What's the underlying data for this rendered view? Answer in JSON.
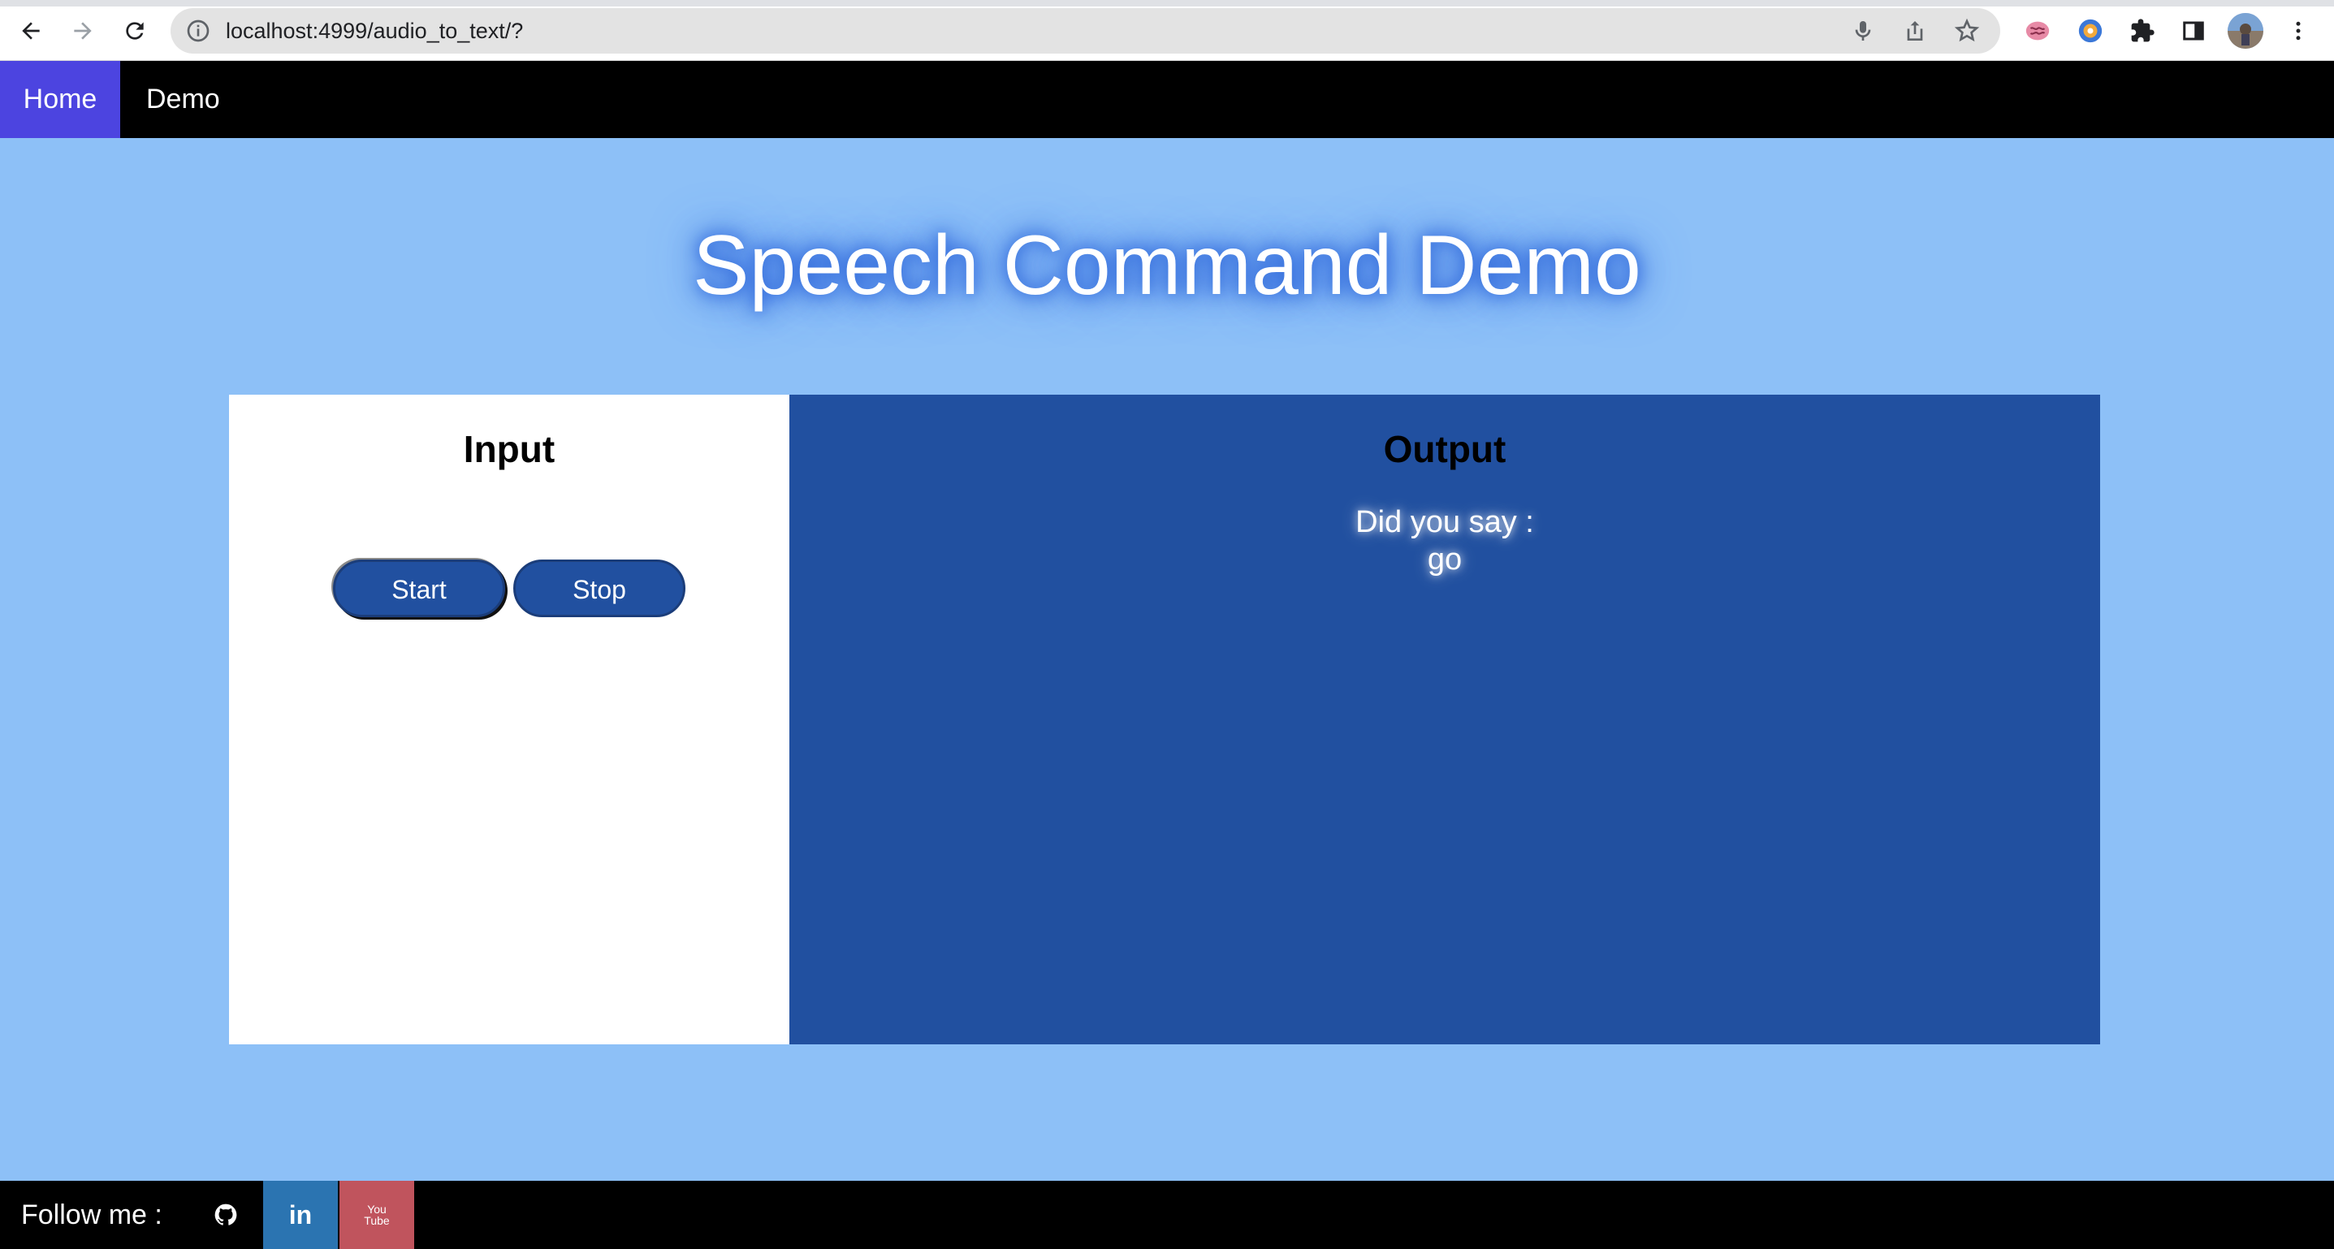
{
  "browser": {
    "url": "localhost:4999/audio_to_text/?",
    "toolbar_icons": [
      "back-arrow-icon",
      "forward-arrow-icon",
      "reload-icon",
      "site-info-icon",
      "microphone-icon",
      "share-icon",
      "bookmark-star-icon",
      "extension-brain-icon",
      "extension-donut-icon",
      "extensions-puzzle-icon",
      "side-panel-icon",
      "profile-avatar",
      "kebab-menu-icon"
    ]
  },
  "nav": {
    "home": "Home",
    "demo": "Demo",
    "active_color": "#4c44e0"
  },
  "page": {
    "title": "Speech Command Demo",
    "background": "#8dc0f7"
  },
  "input_panel": {
    "heading": "Input",
    "start_label": "Start",
    "stop_label": "Stop"
  },
  "output_panel": {
    "heading": "Output",
    "prompt": "Did you say :",
    "result": "go",
    "background": "#2150a0"
  },
  "footer": {
    "follow_label": "Follow me :",
    "links": [
      {
        "icon": "github-icon",
        "color": "#000000"
      },
      {
        "icon": "linkedin-icon",
        "text": "in",
        "color": "#2b74b1"
      },
      {
        "icon": "youtube-icon",
        "text": "You Tube",
        "color": "#c0545d"
      }
    ]
  }
}
